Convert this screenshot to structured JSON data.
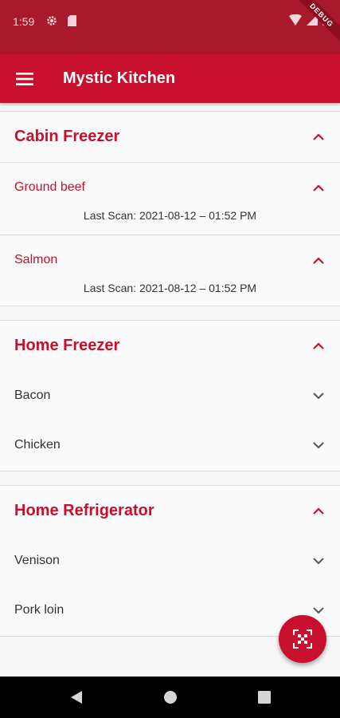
{
  "status_bar": {
    "time": "1:59",
    "debug_label": "DEBUG"
  },
  "app_bar": {
    "title": "Mystic Kitchen"
  },
  "sections": [
    {
      "title": "Cabin Freezer",
      "expanded": true,
      "items": [
        {
          "label": "Ground beef",
          "expanded": true,
          "last_scan": "Last Scan: 2021-08-12 – 01:52 PM"
        },
        {
          "label": "Salmon",
          "expanded": true,
          "last_scan": "Last Scan: 2021-08-12 – 01:52 PM"
        }
      ]
    },
    {
      "title": "Home Freezer",
      "expanded": true,
      "items": [
        {
          "label": "Bacon",
          "expanded": false
        },
        {
          "label": "Chicken",
          "expanded": false
        }
      ]
    },
    {
      "title": "Home Refrigerator",
      "expanded": true,
      "items": [
        {
          "label": "Venison",
          "expanded": false
        },
        {
          "label": "Pork loin",
          "expanded": false
        }
      ]
    }
  ],
  "fab": {
    "icon": "qr-scan-icon"
  },
  "nav": {
    "back_icon": "back-triangle-icon",
    "home_icon": "home-circle-icon",
    "recents_icon": "recents-square-icon"
  },
  "colors": {
    "primary": "#c8102e",
    "status_bar": "#a8192b",
    "background": "#f7f7f7"
  }
}
